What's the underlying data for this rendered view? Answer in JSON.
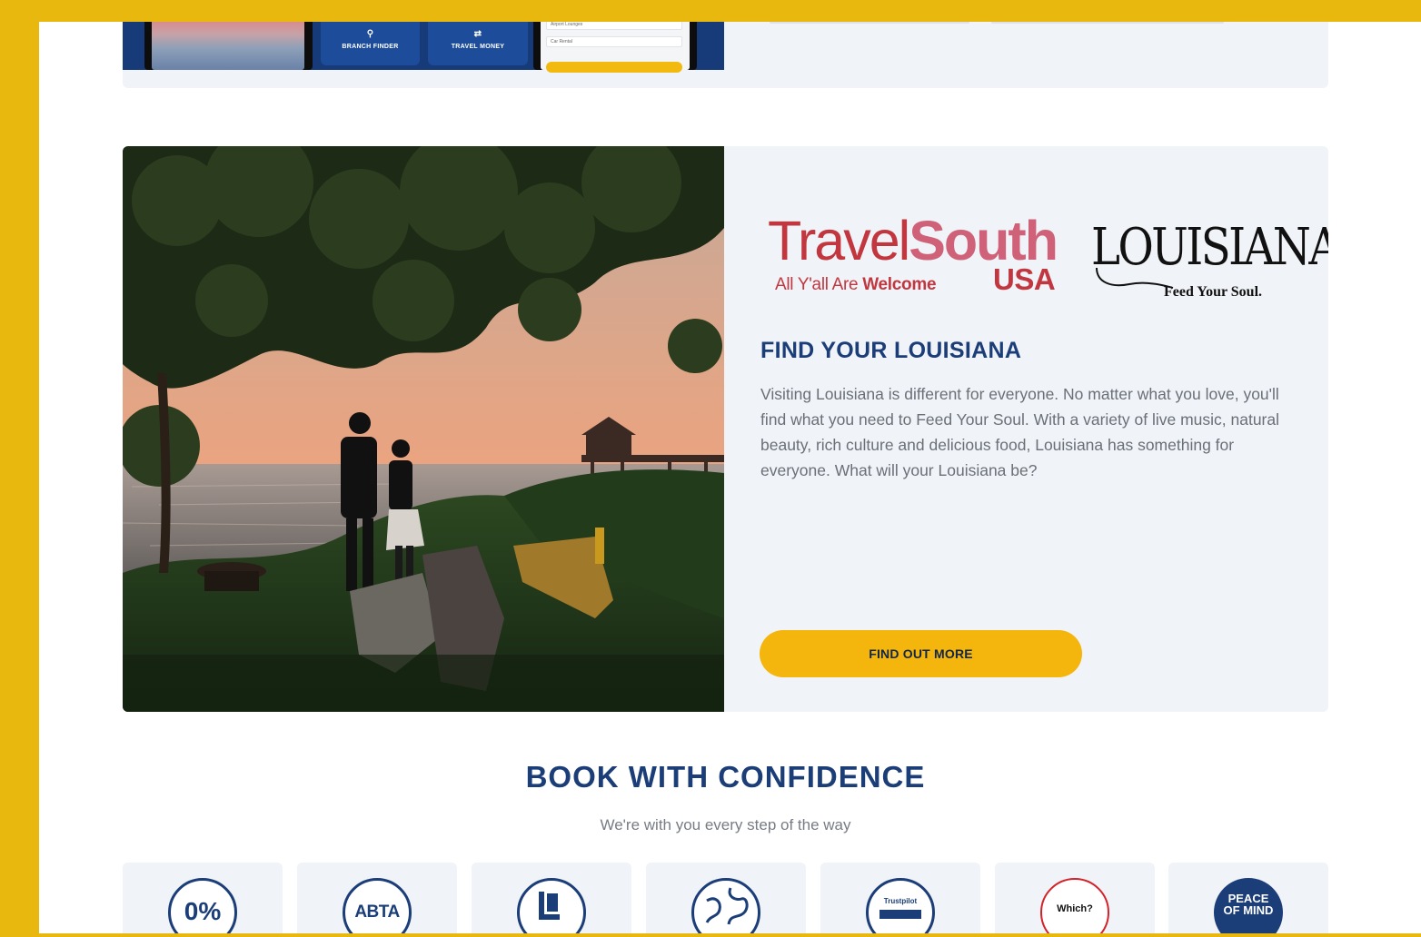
{
  "promo": {
    "tiles": [
      {
        "icon": "location-pin-icon",
        "label": "BRANCH FINDER"
      },
      {
        "icon": "currency-icon",
        "label": "TRAVEL MONEY"
      }
    ],
    "phone_rows": [
      "Airport Lounges",
      "Car Rental"
    ]
  },
  "feature": {
    "travelsouth": {
      "word_travel": "Travel",
      "word_south": "South",
      "tag_prefix": "All Y'all Are ",
      "tag_bold": "Welcome",
      "usa": "USA"
    },
    "louisiana": {
      "word": "LOUISIANA",
      "tag": "Feed Your Soul."
    },
    "heading": "FIND YOUR LOUISIANA",
    "description": "Visiting Louisiana is different for everyone. No matter what you love, you'll find what you need to Feed Your Soul. With a variety of live music, natural beauty, rich culture and delicious food, Louisiana has something for everyone. What will your Louisiana be?",
    "cta_label": "FIND OUT MORE"
  },
  "confidence": {
    "title": "BOOK WITH CONFIDENCE",
    "subtitle": "We're with you every step of the way",
    "badges": [
      {
        "icon": "zero-percent-icon",
        "text": "0%"
      },
      {
        "icon": "abta-icon",
        "text": "ABTA"
      },
      {
        "icon": "atol-icon",
        "text": ""
      },
      {
        "icon": "globe-icon",
        "text": ""
      },
      {
        "icon": "trustpilot-icon",
        "text": "Trustpilot"
      },
      {
        "icon": "which-icon",
        "text": "Which?"
      },
      {
        "icon": "peace-of-mind-icon",
        "text": "PEACE OF MIND"
      }
    ]
  },
  "colors": {
    "frame": "#e9b80e",
    "navy": "#1b3d78",
    "cta": "#f4b60c",
    "card_bg": "#f0f3f7"
  }
}
